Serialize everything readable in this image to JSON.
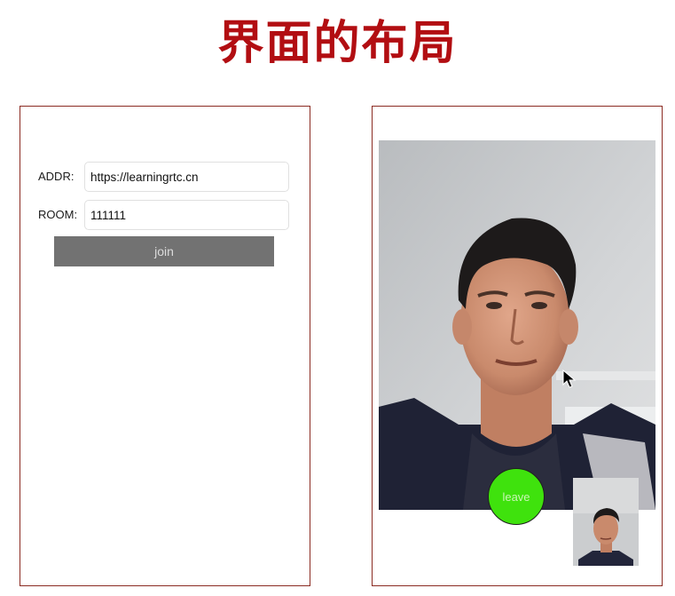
{
  "slide": {
    "title": "界面的布局"
  },
  "join_screen": {
    "addr_label": "ADDR:",
    "addr_value": "https://learningrtc.cn",
    "room_label": "ROOM:",
    "room_value": "111111",
    "join_label": "join"
  },
  "call_screen": {
    "leave_label": "leave",
    "remote_video_icon": "person-video",
    "local_video_icon": "person-video-thumbnail"
  },
  "colors": {
    "title": "#b20e12",
    "frame_border": "#8b2b22",
    "join_button": "#727272",
    "leave_button": "#3fe20d"
  }
}
